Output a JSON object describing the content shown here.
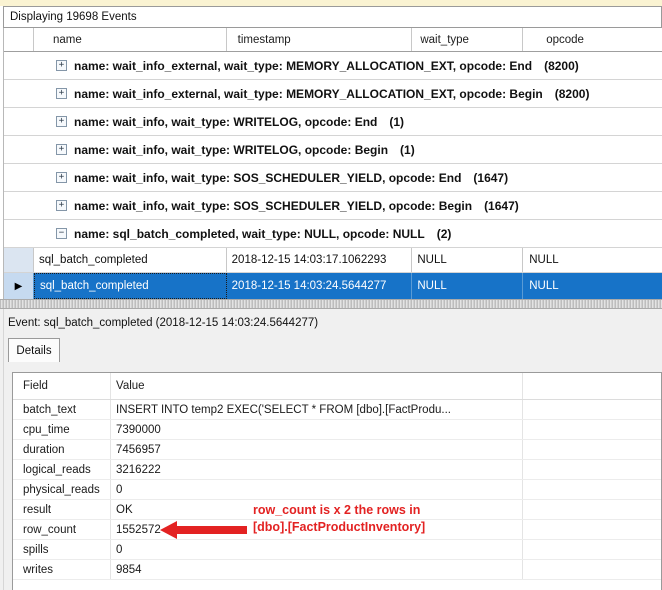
{
  "title_bar": {
    "text": "Displaying 19698 Events"
  },
  "grid": {
    "columns": [
      "name",
      "timestamp",
      "wait_type",
      "opcode"
    ],
    "groups": [
      {
        "expander": "+",
        "label": "name: wait_info_external, wait_type: MEMORY_ALLOCATION_EXT, opcode: End",
        "count": "(8200)"
      },
      {
        "expander": "+",
        "label": "name: wait_info_external, wait_type: MEMORY_ALLOCATION_EXT, opcode: Begin",
        "count": "(8200)"
      },
      {
        "expander": "+",
        "label": "name: wait_info, wait_type: WRITELOG, opcode: End",
        "count": "(1)"
      },
      {
        "expander": "+",
        "label": "name: wait_info, wait_type: WRITELOG, opcode: Begin",
        "count": "(1)"
      },
      {
        "expander": "+",
        "label": "name: wait_info, wait_type: SOS_SCHEDULER_YIELD, opcode: End",
        "count": "(1647)"
      },
      {
        "expander": "+",
        "label": "name: wait_info, wait_type: SOS_SCHEDULER_YIELD, opcode: Begin",
        "count": "(1647)"
      },
      {
        "expander": "−",
        "label": "name: sql_batch_completed, wait_type: NULL, opcode: NULL",
        "count": "(2)"
      }
    ],
    "rows": [
      {
        "name": "sql_batch_completed",
        "timestamp": "2018-12-15 14:03:17.1062293",
        "wait_type": "NULL",
        "opcode": "NULL"
      },
      {
        "name": "sql_batch_completed",
        "timestamp": "2018-12-15 14:03:24.5644277",
        "wait_type": "NULL",
        "opcode": "NULL"
      }
    ],
    "selector_arrow": "▶"
  },
  "detail_pane": {
    "event_label": "Event: sql_batch_completed (2018-12-15 14:03:24.5644277)",
    "tab_label": "Details",
    "table": {
      "columns": [
        "Field",
        "Value"
      ],
      "rows": [
        {
          "field": "batch_text",
          "value": "INSERT INTO temp2  EXEC('SELECT * FROM [dbo].[FactProdu..."
        },
        {
          "field": "cpu_time",
          "value": "7390000"
        },
        {
          "field": "duration",
          "value": "7456957"
        },
        {
          "field": "logical_reads",
          "value": "3216222"
        },
        {
          "field": "physical_reads",
          "value": "0"
        },
        {
          "field": "result",
          "value": "OK"
        },
        {
          "field": "row_count",
          "value": "1552572"
        },
        {
          "field": "spills",
          "value": "0"
        },
        {
          "field": "writes",
          "value": "9854"
        }
      ]
    },
    "annotation": {
      "line1": "row_count is x 2 the rows in",
      "line2": "[dbo].[FactProductInventory]",
      "color": "#e32222"
    }
  },
  "colors": {
    "selection_blue": "#1773c8",
    "top_strip": "#faf3d2",
    "pane_gray": "#f0f0f0",
    "annotation_red": "#e32222"
  }
}
